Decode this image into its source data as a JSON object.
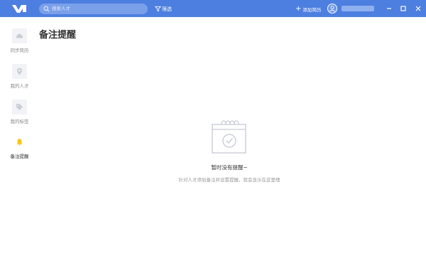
{
  "topbar": {
    "logo_icon": "app-logo-icon",
    "search_placeholder": "搜索人才",
    "filter_label": "筛选",
    "add_resume_label": "添加简历",
    "accent_color": "#4d7fe0"
  },
  "sidebar": {
    "items": [
      {
        "label": "同步简历",
        "icon": "cloud-icon"
      },
      {
        "label": "我的人才",
        "icon": "location-pin-icon"
      },
      {
        "label": "我的标签",
        "icon": "tag-icon"
      },
      {
        "label": "备注提醒",
        "icon": "bell-icon",
        "active": true
      }
    ]
  },
  "main": {
    "title": "备注提醒",
    "empty_state": {
      "icon": "calendar-check-icon",
      "title": "暂时没有提醒~",
      "description": "针对人才添加备注并设置提醒，就会显示在这里噢"
    }
  }
}
